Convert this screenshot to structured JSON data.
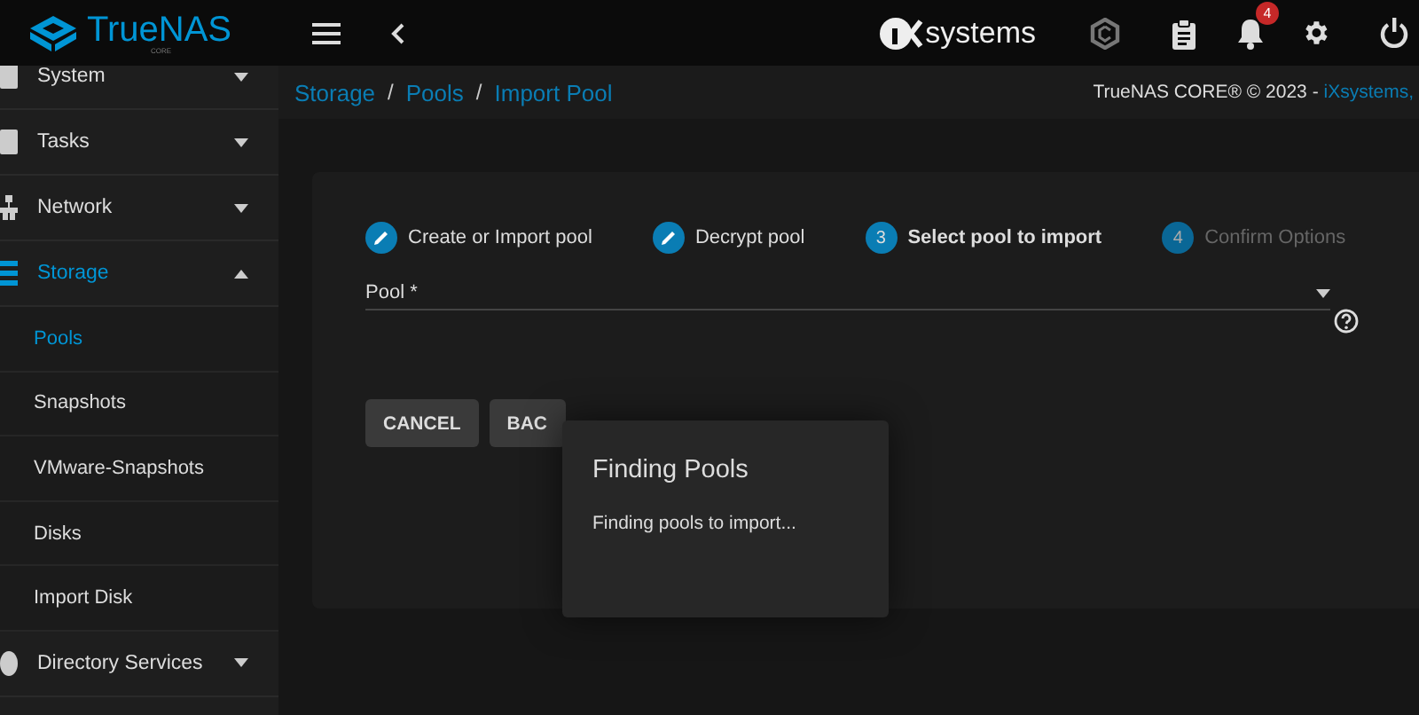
{
  "topbar": {
    "logo": "TrueNAS",
    "logo_sub": "CORE",
    "vendor": "systems",
    "notification_count": "4"
  },
  "sidebar": {
    "items": [
      {
        "label": "System",
        "expanded": false,
        "selected": false
      },
      {
        "label": "Tasks",
        "expanded": false,
        "selected": false
      },
      {
        "label": "Network",
        "expanded": false,
        "selected": false
      },
      {
        "label": "Storage",
        "expanded": true,
        "selected": true,
        "children": [
          {
            "label": "Pools",
            "selected": true
          },
          {
            "label": "Snapshots",
            "selected": false
          },
          {
            "label": "VMware-Snapshots",
            "selected": false
          },
          {
            "label": "Disks",
            "selected": false
          },
          {
            "label": "Import Disk",
            "selected": false
          }
        ]
      },
      {
        "label": "Directory Services",
        "expanded": false,
        "selected": false
      }
    ]
  },
  "breadcrumb": [
    {
      "label": "Storage"
    },
    {
      "separator": "/",
      "label": "Pools"
    },
    {
      "separator": "/",
      "label": "Import Pool"
    }
  ],
  "copyright": {
    "text": "TrueNAS CORE® © 2023 - ",
    "link": "iXsystems,"
  },
  "steps": [
    {
      "kind": "done",
      "label": "Create or Import pool"
    },
    {
      "kind": "done",
      "label": "Decrypt pool"
    },
    {
      "kind": "active",
      "number": "3",
      "label": "Select pool to import"
    },
    {
      "kind": "pending",
      "number": "4",
      "label": "Confirm Options"
    }
  ],
  "pool_field": {
    "label": "Pool *"
  },
  "buttons": [
    "CANCEL",
    "BAC"
  ],
  "dialog": {
    "title": "Finding Pools",
    "message": "Finding pools to import..."
  }
}
